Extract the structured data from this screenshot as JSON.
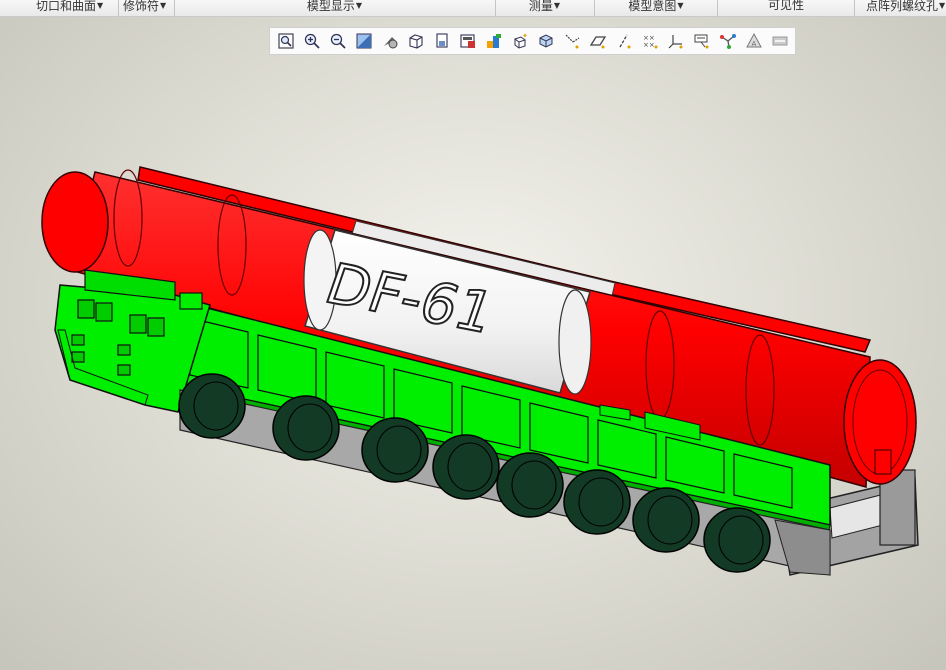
{
  "ribbon": {
    "groups": [
      {
        "label": "切口和曲面",
        "dropdown": true
      },
      {
        "label": "修饰符",
        "dropdown": true
      },
      {
        "label": "模型显示",
        "dropdown": true
      },
      {
        "label": "测量",
        "dropdown": true
      },
      {
        "label": "模型意图",
        "dropdown": true
      },
      {
        "label": "可见性",
        "dropdown": false
      },
      {
        "label": "点阵列螺纹孔",
        "dropdown": true
      }
    ]
  },
  "view_toolbar": {
    "buttons": [
      "refit-icon",
      "zoom-in-icon",
      "zoom-out-icon",
      "repaint-icon",
      "display-style-icon",
      "saved-orientations-icon",
      "named-views-icon",
      "view-manager-icon",
      "appearance-icon",
      "perspective-icon",
      "section-icon",
      "datum-display-icon",
      "plane-display-icon",
      "axis-display-icon",
      "point-display-icon",
      "csys-display-icon",
      "annotation-display-icon",
      "spin-center-icon",
      "simplified-rep-icon",
      "render-settings-icon"
    ]
  },
  "model": {
    "label": "DF-61",
    "colors": {
      "missile_red": "#ff0000",
      "chassis_green": "#00ee00",
      "wheel_dark": "#123a25",
      "frame_gray": "#a8a8a8",
      "band_white": "#f4f4f4"
    }
  }
}
